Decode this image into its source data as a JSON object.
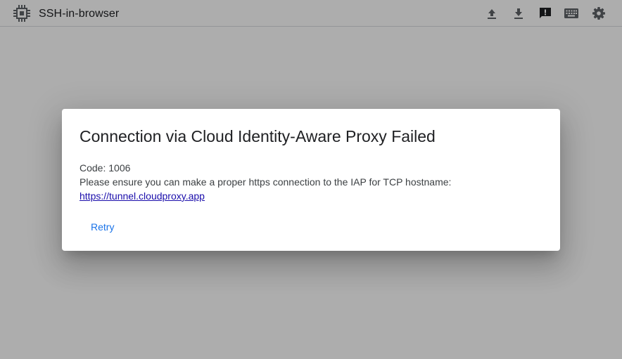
{
  "app": {
    "title": "SSH-in-browser",
    "logo_icon": "chip-icon"
  },
  "toolbar": {
    "buttons": [
      {
        "name": "upload-icon"
      },
      {
        "name": "download-icon"
      },
      {
        "name": "feedback-icon"
      },
      {
        "name": "keyboard-icon"
      },
      {
        "name": "settings-gear-icon"
      }
    ]
  },
  "dialog": {
    "title": "Connection via Cloud Identity-Aware Proxy Failed",
    "code_line": "Code: 1006",
    "message": "Please ensure you can make a proper https connection to the IAP for TCP hostname:",
    "link": "https://tunnel.cloudproxy.app",
    "retry_label": "Retry"
  },
  "colors": {
    "accent": "#1a73e8",
    "link": "#1a0dab",
    "scrim": "rgba(0,0,0,0.32)",
    "icon": "#5f6368"
  }
}
